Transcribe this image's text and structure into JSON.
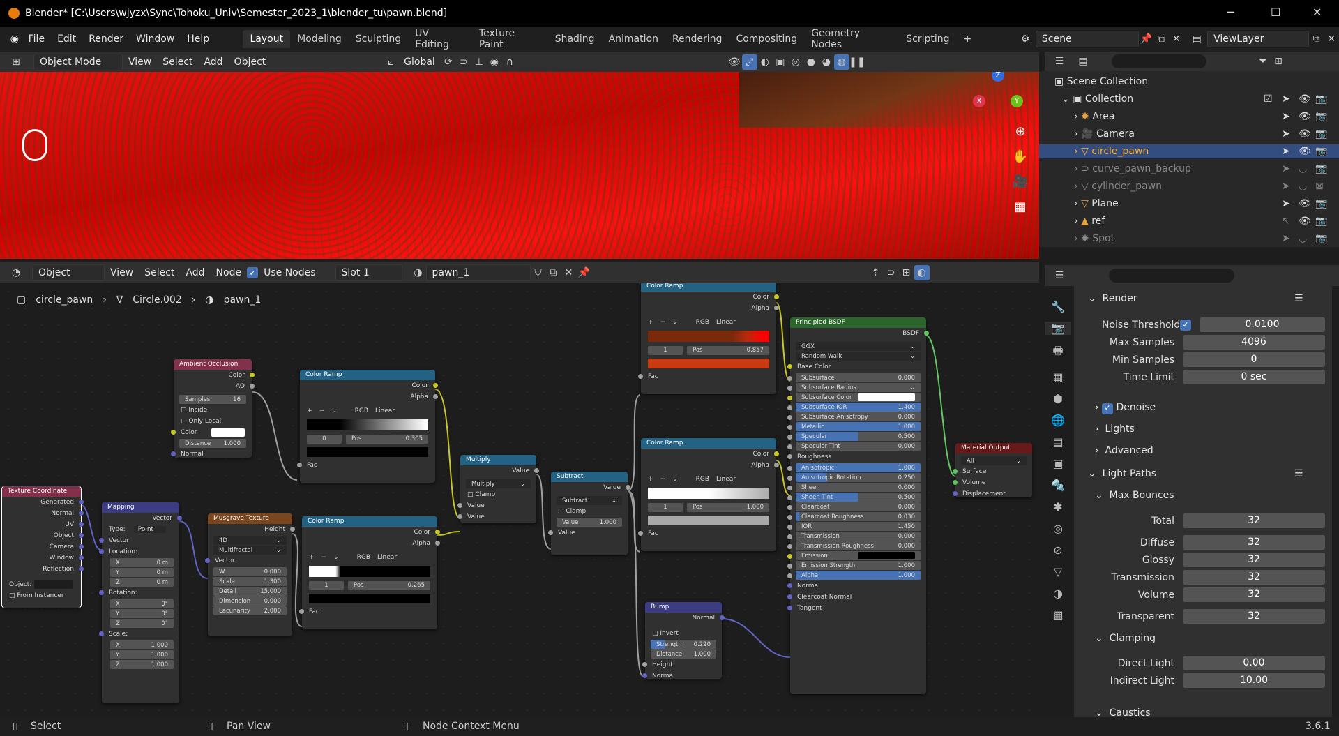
{
  "window": {
    "title": "Blender* [C:\\Users\\wjyzx\\Sync\\Tohoku_Univ\\Semester_2023_1\\blender_tu\\pawn.blend]",
    "min": "─",
    "max": "☐",
    "close": "✕"
  },
  "menu": [
    "File",
    "Edit",
    "Render",
    "Window",
    "Help"
  ],
  "workspaces": [
    "Layout",
    "Modeling",
    "Sculpting",
    "UV Editing",
    "Texture Paint",
    "Shading",
    "Animation",
    "Rendering",
    "Compositing",
    "Geometry Nodes",
    "Scripting"
  ],
  "add_tab": "+",
  "scene": "Scene",
  "view_layer": "ViewLayer",
  "viewport_header": {
    "mode": "Object Mode",
    "menus": [
      "View",
      "Select",
      "Add",
      "Object"
    ],
    "orientation": "Global"
  },
  "gizmo": {
    "z": "Z",
    "y": "Y",
    "x": "X"
  },
  "node_header": {
    "type": "Object",
    "menus": [
      "View",
      "Select",
      "Add",
      "Node"
    ],
    "use_nodes": "Use Nodes",
    "slot": "Slot 1",
    "material": "pawn_1"
  },
  "breadcrumb": [
    "circle_pawn",
    "Circle.002",
    "pawn_1"
  ],
  "nodes": {
    "ao": {
      "title": "Ambient Occlusion",
      "out1": "Color",
      "out2": "AO",
      "samples_l": "Samples",
      "samples": "16",
      "inside": "Inside",
      "only_local": "Only Local",
      "color": "Color",
      "distance_l": "Distance",
      "distance": "1.000",
      "normal": "Normal"
    },
    "texcoord": {
      "title": "Texture Coordinate",
      "outs": [
        "Generated",
        "Normal",
        "UV",
        "Object",
        "Camera",
        "Window",
        "Reflection"
      ],
      "object": "Object:",
      "from_instancer": "From Instancer"
    },
    "mapping": {
      "title": "Mapping",
      "vector_out": "Vector",
      "type_l": "Type:",
      "type": "Point",
      "vector": "Vector",
      "location": "Location:",
      "lx": "0 m",
      "ly": "0 m",
      "lz": "0 m",
      "rotation": "Rotation:",
      "rx": "0°",
      "ry": "0°",
      "rz": "0°",
      "scale": "Scale:",
      "sx": "1.000",
      "sy": "1.000",
      "sz": "1.000",
      "X": "X",
      "Y": "Y",
      "Z": "Z"
    },
    "musgrave": {
      "title": "Musgrave Texture",
      "height": "Height",
      "dim": "4D",
      "type": "Multifractal",
      "vector": "Vector",
      "w_l": "W",
      "w": "0.000",
      "scale_l": "Scale",
      "scale": "1.300",
      "detail_l": "Detail",
      "detail": "15.000",
      "dimension_l": "Dimension",
      "dimension": "0.000",
      "lacunarity_l": "Lacunarity",
      "lacunarity": "2.000"
    },
    "ramp1": {
      "title": "Color Ramp",
      "color": "Color",
      "alpha": "Alpha",
      "rgb": "RGB",
      "interp": "Linear",
      "idx": "0",
      "pos_l": "Pos",
      "pos": "0.305",
      "fac": "Fac"
    },
    "ramp2": {
      "title": "Color Ramp",
      "color": "Color",
      "alpha": "Alpha",
      "rgb": "RGB",
      "interp": "Linear",
      "idx": "1",
      "pos_l": "Pos",
      "pos": "0.265",
      "fac": "Fac"
    },
    "multiply": {
      "title": "Multiply",
      "value_out": "Value",
      "op": "Multiply",
      "clamp": "Clamp",
      "v1": "Value",
      "v2": "Value"
    },
    "subtract": {
      "title": "Subtract",
      "value_out": "Value",
      "op": "Subtract",
      "clamp": "Clamp",
      "value_l": "Value",
      "value": "1.000",
      "v2": "Value"
    },
    "ramp3": {
      "title": "Color Ramp",
      "color": "Color",
      "alpha": "Alpha",
      "rgb": "RGB",
      "interp": "Linear",
      "idx": "1",
      "pos_l": "Pos",
      "pos": "0.857",
      "fac": "Fac"
    },
    "ramp4": {
      "title": "Color Ramp",
      "color": "Color",
      "alpha": "Alpha",
      "rgb": "RGB",
      "interp": "Linear",
      "idx": "1",
      "pos_l": "Pos",
      "pos": "1.000",
      "fac": "Fac"
    },
    "bump": {
      "title": "Bump",
      "normal_out": "Normal",
      "invert": "Invert",
      "strength_l": "Strength",
      "strength": "0.220",
      "distance_l": "Distance",
      "distance": "1.000",
      "height": "Height",
      "normal": "Normal"
    },
    "bsdf": {
      "title": "Principled BSDF",
      "bsdf": "BSDF",
      "dist": "GGX",
      "sss": "Random Walk",
      "base_color": "Base Color",
      "rows": [
        [
          "Subsurface",
          "0.000",
          0
        ],
        [
          "Subsurface Radius",
          "",
          0
        ],
        [
          "Subsurface Color",
          "",
          0
        ],
        [
          "Subsurface IOR",
          "1.400",
          1
        ],
        [
          "Subsurface Anisotropy",
          "0.000",
          0
        ],
        [
          "Metallic",
          "1.000",
          1
        ],
        [
          "Specular",
          "0.500",
          0.5
        ],
        [
          "Specular Tint",
          "0.000",
          0
        ],
        [
          "Roughness",
          "",
          -1
        ],
        [
          "Anisotropic",
          "1.000",
          1
        ],
        [
          "Anisotropic Rotation",
          "0.250",
          0.25
        ],
        [
          "Sheen",
          "0.000",
          0
        ],
        [
          "Sheen Tint",
          "0.500",
          0.5
        ],
        [
          "Clearcoat",
          "0.000",
          0
        ],
        [
          "Clearcoat Roughness",
          "0.030",
          0.03
        ],
        [
          "IOR",
          "1.450",
          0
        ],
        [
          "Transmission",
          "0.000",
          0
        ],
        [
          "Transmission Roughness",
          "0.000",
          0
        ],
        [
          "Emission",
          "",
          0
        ],
        [
          "Emission Strength",
          "1.000",
          0
        ],
        [
          "Alpha",
          "1.000",
          1
        ],
        [
          "Normal",
          "",
          -1
        ],
        [
          "Clearcoat Normal",
          "",
          -1
        ],
        [
          "Tangent",
          "",
          -1
        ]
      ]
    },
    "output": {
      "title": "Material Output",
      "target": "All",
      "surface": "Surface",
      "volume": "Volume",
      "displacement": "Displacement"
    }
  },
  "outliner": {
    "scene_collection": "Scene Collection",
    "collection": "Collection",
    "items": [
      "Area",
      "Camera",
      "circle_pawn",
      "curve_pawn_backup",
      "cylinder_pawn",
      "Plane",
      "ref",
      "Spot"
    ]
  },
  "props": {
    "render": "Render",
    "noise_threshold_l": "Noise Threshold",
    "noise_threshold": "0.0100",
    "max_samples_l": "Max Samples",
    "max_samples": "4096",
    "min_samples_l": "Min Samples",
    "min_samples": "0",
    "time_limit_l": "Time Limit",
    "time_limit": "0 sec",
    "denoise": "Denoise",
    "lights": "Lights",
    "advanced": "Advanced",
    "light_paths": "Light Paths",
    "max_bounces": "Max Bounces",
    "total_l": "Total",
    "total": "32",
    "diffuse_l": "Diffuse",
    "diffuse": "32",
    "glossy_l": "Glossy",
    "glossy": "32",
    "transmission_l": "Transmission",
    "transmission": "32",
    "volume_l": "Volume",
    "volume": "32",
    "transparent_l": "Transparent",
    "transparent": "32",
    "clamping": "Clamping",
    "direct_l": "Direct Light",
    "direct": "0.00",
    "indirect_l": "Indirect Light",
    "indirect": "10.00",
    "caustics": "Caustics"
  },
  "status": {
    "select": "Select",
    "pan": "Pan View",
    "ctx": "Node Context Menu",
    "version": "3.6.1"
  }
}
